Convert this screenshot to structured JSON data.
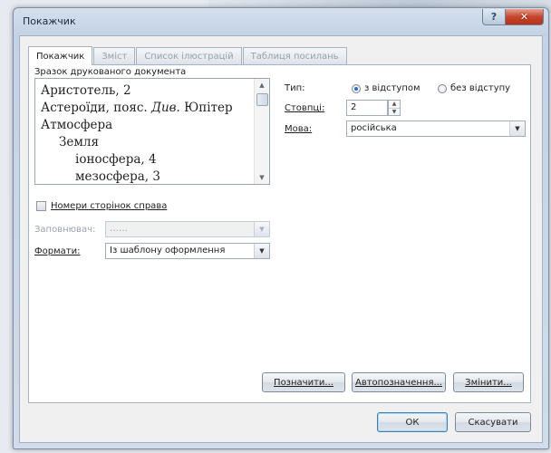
{
  "window": {
    "title": "Покажчик",
    "help_icon": "?",
    "close_icon": "✕"
  },
  "tabs": [
    {
      "label": "Покажчик",
      "active": true
    },
    {
      "label": "Зміст",
      "active": false
    },
    {
      "label": "Список ілюстрацій",
      "active": false
    },
    {
      "label": "Таблиця посилань",
      "active": false
    }
  ],
  "preview": {
    "label": "Зразок друкованого документа",
    "lines": [
      {
        "text": "Аристотель, 2"
      },
      {
        "text_before": "Астероїди, пояс. ",
        "text_italic": "Див.",
        "text_after": " Юпітер"
      },
      {
        "text": "Атмосфера"
      },
      {
        "text": "Земля"
      },
      {
        "text": "іоносфера, 4"
      },
      {
        "text": "мезосфера, 3"
      }
    ]
  },
  "type": {
    "label": "Тип:",
    "option_indented": "з відступом",
    "option_run_in": "без відступу",
    "selected": "з відступом"
  },
  "columns": {
    "label": "Стовпці:",
    "value": "2"
  },
  "language": {
    "label": "Мова:",
    "value": "російська"
  },
  "right_align": {
    "label": "Номери сторінок справа",
    "checked": false
  },
  "tab_leader": {
    "label": "Заповнювач:",
    "value": "……"
  },
  "formats": {
    "label": "Формати:",
    "value": "Із шаблону оформлення"
  },
  "buttons": {
    "mark_entry": "Позначити...",
    "automark": "Автопозначення...",
    "modify": "Змінити...",
    "ok": "ОК",
    "cancel": "Скасувати"
  },
  "icons": {
    "scroll_up": "▲",
    "scroll_down": "▼",
    "dropdown": "▼",
    "spin_up": "▲",
    "spin_down": "▼"
  }
}
